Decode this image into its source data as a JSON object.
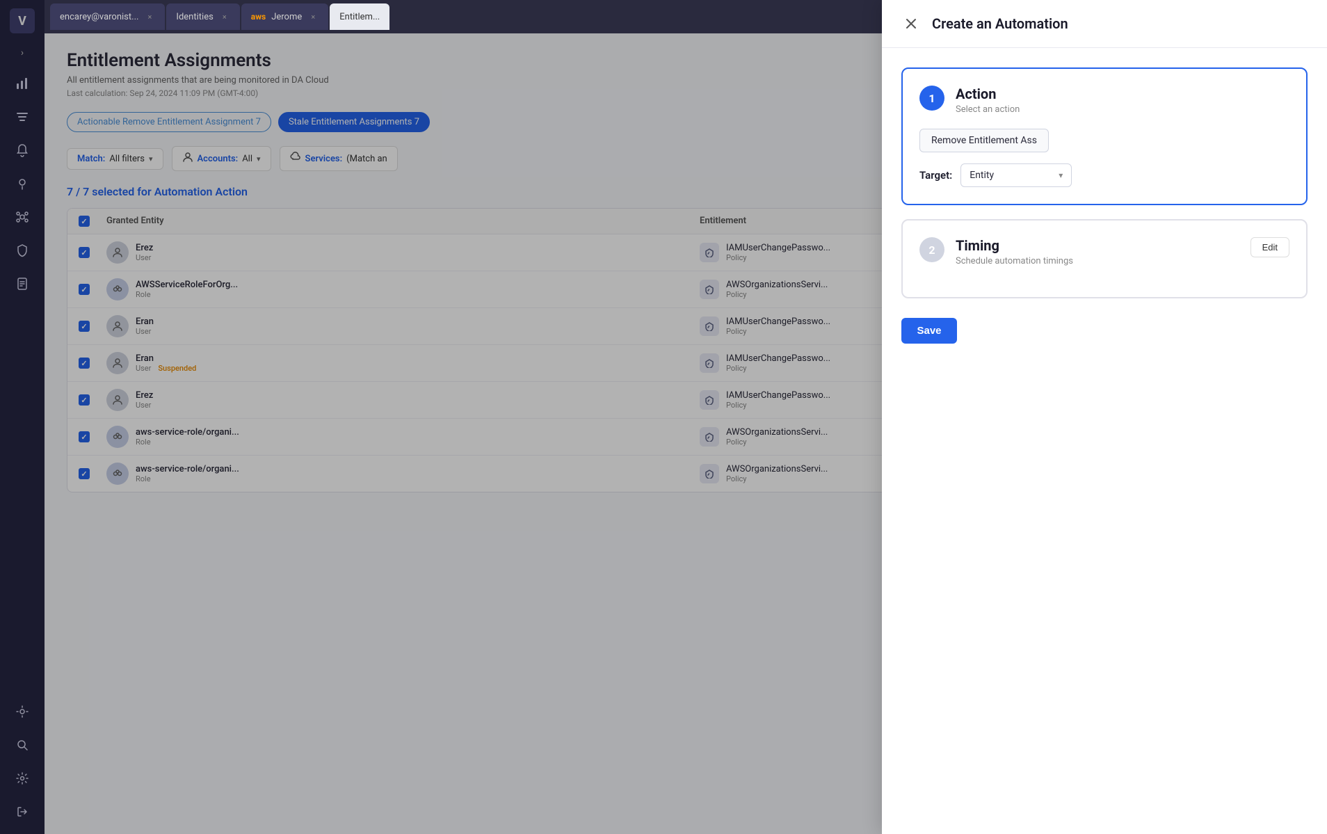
{
  "sidebar": {
    "logo": "V",
    "icons": [
      {
        "name": "analytics-icon",
        "symbol": "📊",
        "active": false
      },
      {
        "name": "filters-icon",
        "symbol": "≡",
        "active": false
      },
      {
        "name": "bell-icon",
        "symbol": "🔔",
        "active": false
      },
      {
        "name": "bulb-icon",
        "symbol": "💡",
        "active": false
      },
      {
        "name": "graph-icon",
        "symbol": "⬡",
        "active": false
      },
      {
        "name": "shield-icon",
        "symbol": "🛡",
        "active": false
      },
      {
        "name": "doc-icon",
        "symbol": "📋",
        "active": false
      },
      {
        "name": "sun-icon",
        "symbol": "☀",
        "active": false
      },
      {
        "name": "search-icon",
        "symbol": "🔍",
        "active": false
      },
      {
        "name": "settings-icon",
        "symbol": "⚙",
        "active": false
      },
      {
        "name": "logout-icon",
        "symbol": "→",
        "active": false
      }
    ]
  },
  "tabs": [
    {
      "id": "encarey",
      "label": "encarey@varonist...",
      "active": false
    },
    {
      "id": "identities",
      "label": "Identities",
      "active": false
    },
    {
      "id": "jerome",
      "label": "Jerome",
      "active": false,
      "icon": "aws"
    },
    {
      "id": "entitlement",
      "label": "Entitlem...",
      "active": true
    }
  ],
  "page": {
    "title": "Entitlement Assignments",
    "subtitle": "All entitlement assignments that are being monitored in DA Cloud",
    "meta": "Last calculation: Sep 24, 2024 11:09 PM (GMT-4:00)",
    "pills": [
      {
        "label": "Actionable Remove Entitlement Assignment 7",
        "active": false
      },
      {
        "label": "Stale Entitlement Assignments 7",
        "active": true
      }
    ],
    "filters": [
      {
        "prefix": "Match:",
        "value": "All filters",
        "icon": ""
      },
      {
        "prefix": "Accounts:",
        "value": "All",
        "icon": "👥"
      },
      {
        "prefix": "Services:",
        "value": "(Match an",
        "icon": "☁"
      }
    ],
    "selection_count": "7 / 7 selected for Automation Action",
    "columns": [
      "",
      "Granted Entity",
      "Entitlement"
    ],
    "rows": [
      {
        "checked": true,
        "entity_name": "Erez",
        "entity_type": "User",
        "entity_kind": "user",
        "suspended": false,
        "entitlement_name": "IAMUserChangePasswo...",
        "entitlement_type": "Policy"
      },
      {
        "checked": true,
        "entity_name": "AWSServiceRoleForOrg...",
        "entity_type": "Role",
        "entity_kind": "role",
        "suspended": false,
        "entitlement_name": "AWSOrganizationsServi...",
        "entitlement_type": "Policy"
      },
      {
        "checked": true,
        "entity_name": "Eran",
        "entity_type": "User",
        "entity_kind": "user",
        "suspended": false,
        "entitlement_name": "IAMUserChangePasswo...",
        "entitlement_type": "Policy"
      },
      {
        "checked": true,
        "entity_name": "Eran",
        "entity_type": "User",
        "entity_kind": "user",
        "suspended": true,
        "entitlement_name": "IAMUserChangePasswo...",
        "entitlement_type": "Policy"
      },
      {
        "checked": true,
        "entity_name": "Erez",
        "entity_type": "User",
        "entity_kind": "user",
        "suspended": false,
        "entitlement_name": "IAMUserChangePasswo...",
        "entitlement_type": "Policy"
      },
      {
        "checked": true,
        "entity_name": "aws-service-role/organi...",
        "entity_type": "Role",
        "entity_kind": "role",
        "suspended": false,
        "entitlement_name": "AWSOrganizationsServi...",
        "entitlement_type": "Policy"
      },
      {
        "checked": true,
        "entity_name": "aws-service-role/organi...",
        "entity_type": "Role",
        "entity_kind": "role",
        "suspended": false,
        "entitlement_name": "AWSOrganizationsServi...",
        "entitlement_type": "Policy"
      }
    ]
  },
  "automation_panel": {
    "title": "Create an Automation",
    "steps": [
      {
        "number": "1",
        "title": "Action",
        "subtitle": "Select an action",
        "active": true,
        "action_label": "Remove Entitlement Ass",
        "target_label": "Target:",
        "target_value": "Entity",
        "has_edit": false
      },
      {
        "number": "2",
        "title": "Timing",
        "subtitle": "Schedule automation timings",
        "active": false,
        "has_edit": true,
        "edit_label": "Edit"
      }
    ],
    "save_label": "Save"
  }
}
